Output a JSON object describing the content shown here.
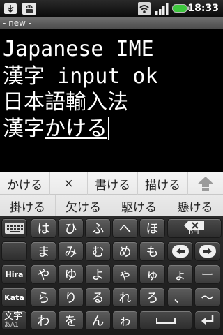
{
  "status_bar": {
    "time": "18:33"
  },
  "title_bar": {
    "title": "- new -"
  },
  "editor": {
    "line1": "Japanese IME",
    "line2_kanji": "漢字",
    "line2_rest": " input ok",
    "line3": "日本語輸入法",
    "line4_committed": "漢字",
    "line4_composing": "かける"
  },
  "candidates": {
    "row1": [
      "かける",
      "×",
      "書ける",
      "描ける"
    ],
    "row2": [
      "掛ける",
      "欠ける",
      "駆ける",
      "懸ける"
    ]
  },
  "keyboard": {
    "row1": [
      "は",
      "ひ",
      "ふ",
      "へ",
      "ほ"
    ],
    "row2": [
      "ま",
      "み",
      "む",
      "め",
      "も"
    ],
    "row3": [
      "や",
      "ゆ",
      "よ",
      "ゃ",
      "ゅ",
      "ょ",
      "ー"
    ],
    "row4": [
      "ら",
      "り",
      "る",
      "れ",
      "ろ",
      "、",
      "〜"
    ],
    "row5": [
      "わ",
      "を",
      "ん",
      "ゎ"
    ],
    "hira_label": "Hira",
    "kata_label": "Kata",
    "moji_label": "文字",
    "moji_sub": "あA1",
    "del_label": "DEL"
  },
  "colors": {
    "accent_battery": "#3ec73e",
    "underline_rule": "#2e6d7a"
  }
}
